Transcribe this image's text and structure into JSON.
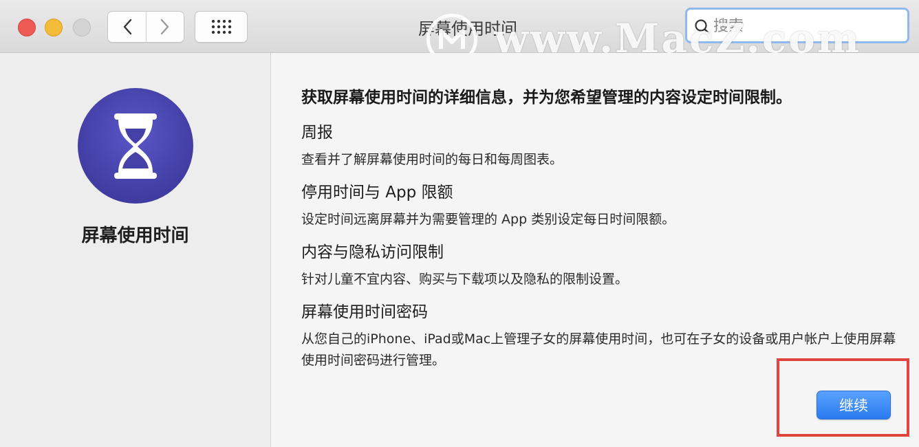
{
  "window": {
    "title": "屏幕使用时间"
  },
  "toolbar": {
    "back_icon": "chevron-left-icon",
    "forward_icon": "chevron-right-icon",
    "grid_icon": "grid-icon"
  },
  "search": {
    "placeholder": "搜索"
  },
  "watermark": {
    "text": "www.MacZ.com"
  },
  "sidebar": {
    "app_name": "屏幕使用时间",
    "icon": "hourglass-icon",
    "icon_color": "#4a46b0"
  },
  "main": {
    "heading": "获取屏幕使用时间的详细信息，并为您希望管理的内容设定时间限制。",
    "sections": [
      {
        "title": "周报",
        "desc": "查看并了解屏幕使用时间的每日和每周图表。"
      },
      {
        "title": "停用时间与 App 限额",
        "desc": "设定时间远离屏幕并为需要管理的 App 类别设定每日时间限额。"
      },
      {
        "title": "内容与隐私访问限制",
        "desc": "针对儿童不宜内容、购买与下载项以及隐私的限制设置。"
      },
      {
        "title": "屏幕使用时间密码",
        "desc": "从您自己的iPhone、iPad或Mac上管理子女的屏幕使用时间，也可在子女的设备或用户帐户上使用屏幕使用时间密码进行管理。"
      }
    ],
    "continue_label": "继续"
  },
  "colors": {
    "accent": "#2a7bf0",
    "highlight": "#e0463f"
  }
}
